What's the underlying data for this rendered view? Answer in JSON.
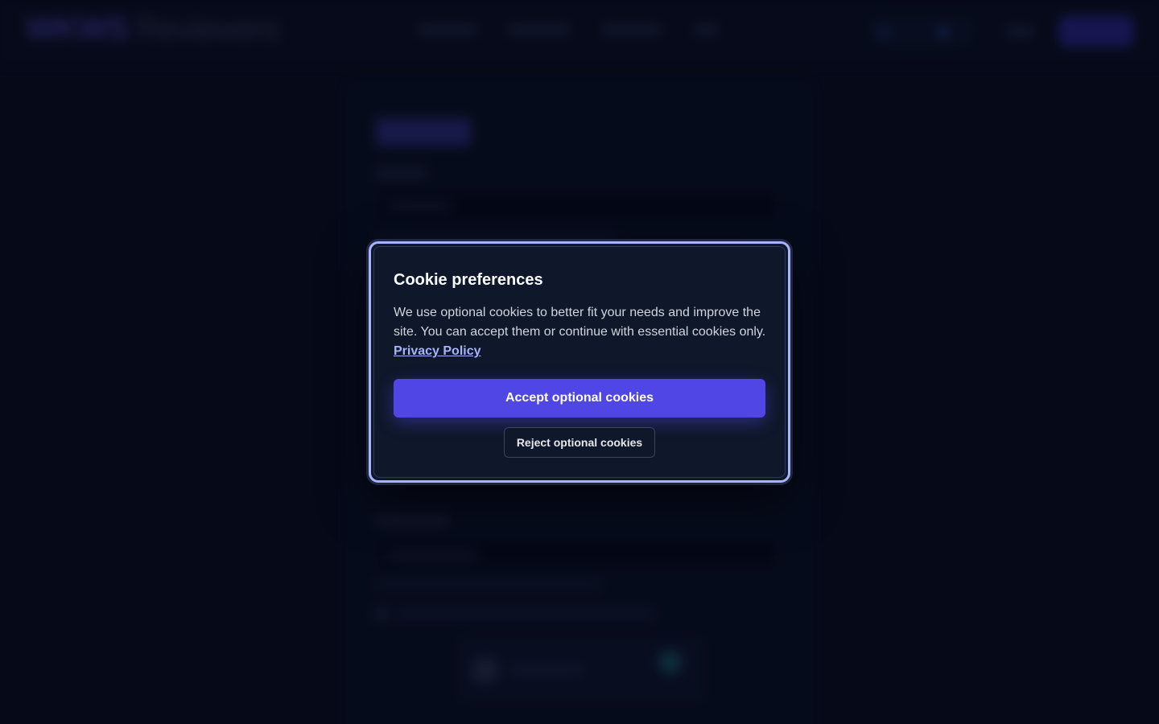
{
  "background_page": {
    "logo_primary": "WKWS",
    "logo_secondary": "Reviewers"
  },
  "cookie_dialog": {
    "title": "Cookie preferences",
    "body": "We use optional cookies to better fit your needs and improve the site. You can accept them or continue with essential cookies only.",
    "privacy_link": "Privacy Policy",
    "accept_label": "Accept optional cookies",
    "reject_label": "Reject optional cookies"
  },
  "colors": {
    "accent": "#4f46e5",
    "focus_ring": "#a5b4fc",
    "dialog_bg": "#0f172a",
    "page_bg": "#070b1d"
  }
}
